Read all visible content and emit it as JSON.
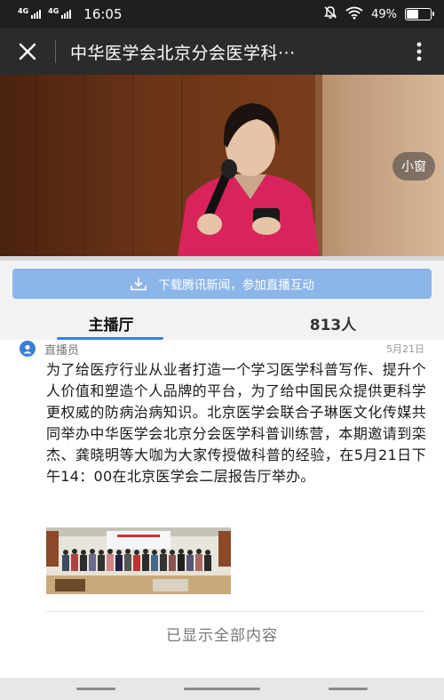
{
  "status_bar": {
    "sim1": "4G",
    "sim2": "4G",
    "time": "16:05",
    "battery": "49%",
    "battery_level": 0.49,
    "icons": [
      "mute-icon",
      "wifi-icon",
      "battery-icon"
    ]
  },
  "header": {
    "title": "中华医学会北京分会医学科···",
    "close_icon": "close-icon",
    "more_icon": "more-vertical-icon"
  },
  "video": {
    "mini_window_label": "小窗"
  },
  "banner": {
    "label": "下载腾讯新闻，参加直播互动",
    "icon": "download-icon"
  },
  "tabs": [
    {
      "label": "主播厅",
      "active": true
    },
    {
      "label": "813人",
      "active": false
    }
  ],
  "post": {
    "author": "直播员",
    "date": "5月21日",
    "body": "为了给医疗行业从业者打造一个学习医学科普写作、提升个人价值和塑造个人品牌的平台，为了给中国民众提供更科学更权威的防病治病知识。北京医学会联合子琳医文化传媒共同举办中华医学会北京分会医学科普训练营，本期邀请到栾杰、龚晓明等大咖为大家传授做科普的经验，在5月21日下午14：00在北京医学会二层报告厅举办。",
    "end_text": "已显示全部内容"
  },
  "colors": {
    "accent": "#3a7fd5",
    "banner": "#8db6e8",
    "title_bar": "#2b2b2b"
  }
}
